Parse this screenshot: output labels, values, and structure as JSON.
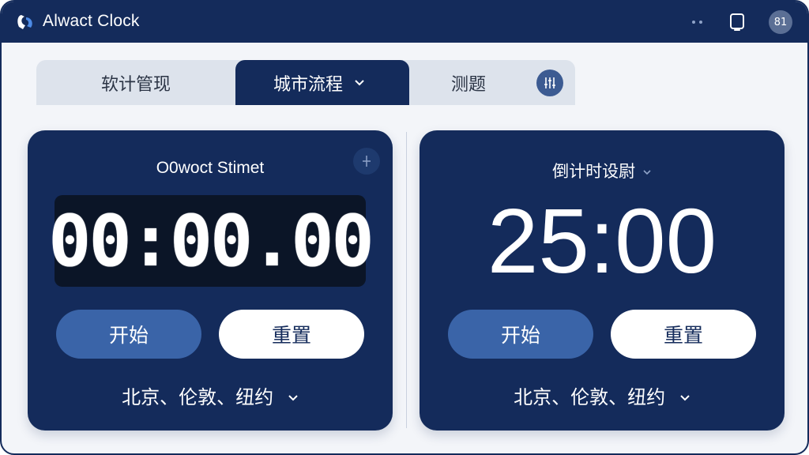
{
  "app": {
    "title": "Alwact Clock",
    "avatar_text": "81",
    "colors": {
      "primary": "#142b5b",
      "accent": "#3a64a8",
      "surface": "#f3f5f9"
    }
  },
  "tabs": [
    {
      "label": "软计管现",
      "active": false
    },
    {
      "label": "城市流程",
      "active": true
    },
    {
      "label": "测题",
      "active": false
    }
  ],
  "stopwatch": {
    "title": "O0woct Stimet",
    "time": "00:00.00",
    "start_label": "开始",
    "reset_label": "重置",
    "cities": "北京、伦敦、纽约"
  },
  "countdown": {
    "title": "倒计时设尉",
    "time": "25:00",
    "start_label": "开始",
    "reset_label": "重置",
    "cities": "北京、伦敦、纽约"
  },
  "icons": {
    "logo": "app-logo-icon",
    "more": "more-dots-icon",
    "notification": "tablet-icon",
    "settings": "sliders-icon",
    "corner": "pin-icon",
    "dropdown": "chevron-down-icon"
  }
}
